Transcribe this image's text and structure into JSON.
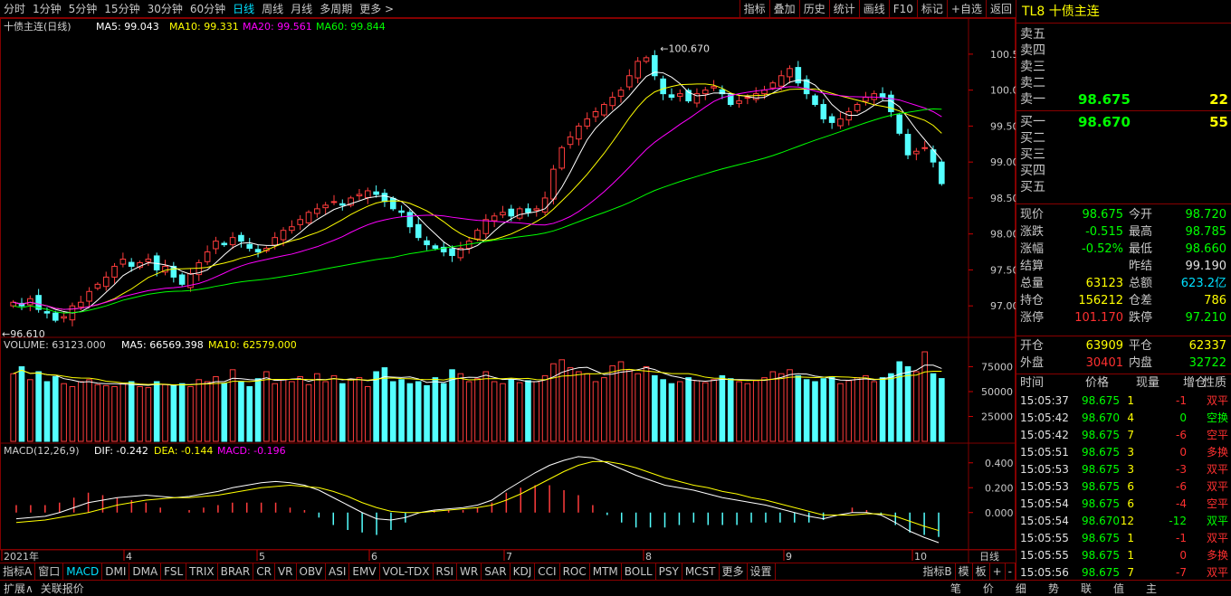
{
  "topbar": {
    "periods": [
      "分时",
      "1分钟",
      "5分钟",
      "15分钟",
      "30分钟",
      "60分钟",
      "日线",
      "周线",
      "月线",
      "多周期",
      "更多 >"
    ],
    "active_index": 6,
    "buttons": [
      "指标",
      "叠加",
      "历史",
      "统计",
      "画线",
      "F10",
      "标记",
      "+自选",
      "返回"
    ]
  },
  "chart": {
    "name": "十债主连(日线)",
    "ma": {
      "ma5": "MA5: 99.043",
      "ma10": "MA10: 99.331",
      "ma20": "MA20: 99.561",
      "ma60": "MA60: 99.844"
    },
    "price_ticks": [
      "100.5",
      "100.0",
      "99.50",
      "99.00",
      "98.50",
      "98.00",
      "97.50",
      "97.00"
    ],
    "high_label": "100.670",
    "low_label": "96.610",
    "volume_title": "VOLUME: 63123.000",
    "volume_ma5": "MA5: 66569.398",
    "volume_ma10": "MA10: 62579.000",
    "volume_ticks": [
      "75000",
      "50000",
      "25000"
    ],
    "macd_title": "MACD(12,26,9)",
    "macd_dif": "DIF: -0.242",
    "macd_dea": "DEA: -0.144",
    "macd_val": "MACD: -0.196",
    "macd_ticks": [
      "0.400",
      "0.200",
      "0.000"
    ],
    "x_labels": [
      "2021年",
      "4",
      "5",
      "6",
      "7",
      "8",
      "9",
      "10"
    ],
    "period_label": "日线",
    "colors": {
      "up": "#ff3c3c",
      "down": "#54ffff",
      "ma5": "#ffffff",
      "ma10": "#ffff00",
      "ma20": "#ff00ff",
      "ma60": "#00ff00",
      "frame": "#800000"
    }
  },
  "chart_data": [
    {
      "type": "candlestick",
      "title": "十债主连(日线)",
      "ylim": [
        96.6,
        100.75
      ],
      "x_labels": [
        "2021年",
        "4",
        "5",
        "6",
        "7",
        "8",
        "9",
        "10"
      ],
      "close": [
        97.05,
        97.0,
        97.1,
        96.95,
        96.9,
        96.8,
        96.85,
        97.0,
        97.05,
        97.2,
        97.3,
        97.4,
        97.55,
        97.65,
        97.55,
        97.6,
        97.65,
        97.5,
        97.55,
        97.4,
        97.3,
        97.45,
        97.6,
        97.75,
        97.9,
        97.85,
        97.95,
        97.9,
        97.8,
        97.75,
        97.8,
        97.95,
        98.05,
        98.1,
        98.2,
        98.3,
        98.35,
        98.4,
        98.45,
        98.4,
        98.5,
        98.55,
        98.6,
        98.55,
        98.45,
        98.35,
        98.3,
        98.1,
        97.95,
        97.85,
        97.8,
        97.75,
        97.7,
        97.8,
        97.9,
        98.05,
        98.2,
        98.25,
        98.3,
        98.25,
        98.35,
        98.3,
        98.35,
        98.5,
        98.9,
        99.2,
        99.35,
        99.5,
        99.6,
        99.7,
        99.8,
        99.9,
        100.0,
        100.2,
        100.4,
        100.45,
        100.2,
        99.95,
        99.9,
        99.95,
        99.85,
        99.95,
        100.0,
        100.05,
        99.95,
        99.8,
        99.85,
        99.9,
        99.95,
        100.0,
        100.1,
        100.2,
        100.3,
        100.1,
        99.95,
        99.8,
        99.6,
        99.55,
        99.6,
        99.7,
        99.8,
        99.9,
        99.95,
        99.9,
        99.7,
        99.4,
        99.1,
        99.15,
        99.2,
        99.0,
        98.7
      ]
    },
    {
      "type": "bar",
      "title": "VOLUME",
      "ylim": [
        0,
        100000
      ],
      "values": [
        68000,
        75000,
        62000,
        70000,
        60000,
        65000,
        58000,
        55000,
        60000,
        62000,
        57000,
        56000,
        55000,
        58000,
        60000,
        55000,
        54000,
        60000,
        57000,
        56000,
        58000,
        55000,
        62000,
        60000,
        65000,
        58000,
        72000,
        60000,
        55000,
        63000,
        70000,
        58000,
        62000,
        60000,
        65000,
        57000,
        68000,
        60000,
        66000,
        58000,
        62000,
        64000,
        55000,
        70000,
        74000,
        60000,
        62000,
        58000,
        60000,
        56000,
        64000,
        58000,
        72000,
        68000,
        60000,
        63000,
        70000,
        60000,
        58000,
        62000,
        59000,
        61000,
        60000,
        66000,
        78000,
        82000,
        74000,
        70000,
        68000,
        60000,
        64000,
        76000,
        80000,
        72000,
        68000,
        75000,
        66000,
        62000,
        58000,
        60000,
        64000,
        61000,
        59000,
        62000,
        66000,
        63000,
        60000,
        58000,
        61000,
        64000,
        70000,
        68000,
        72000,
        66000,
        62000,
        60000,
        63000,
        65000,
        58000,
        61000,
        64000,
        66000,
        60000,
        64000,
        68000,
        80000,
        75000,
        70000,
        90000,
        68000,
        63123
      ]
    },
    {
      "type": "line",
      "title": "MACD(12,26,9)",
      "ylim": [
        -0.3,
        0.5
      ],
      "dif": [
        -0.05,
        -0.04,
        -0.03,
        0.0,
        0.04,
        0.08,
        0.1,
        0.12,
        0.13,
        0.14,
        0.13,
        0.12,
        0.13,
        0.15,
        0.17,
        0.2,
        0.22,
        0.24,
        0.25,
        0.24,
        0.22,
        0.18,
        0.12,
        0.06,
        0.0,
        -0.05,
        -0.06,
        -0.04,
        0.0,
        0.02,
        0.03,
        0.04,
        0.06,
        0.1,
        0.18,
        0.25,
        0.32,
        0.38,
        0.42,
        0.45,
        0.44,
        0.4,
        0.35,
        0.3,
        0.26,
        0.22,
        0.2,
        0.18,
        0.15,
        0.12,
        0.1,
        0.08,
        0.06,
        0.03,
        0.0,
        -0.03,
        -0.05,
        -0.02,
        0.0,
        0.0,
        -0.02,
        -0.08,
        -0.15,
        -0.2,
        -0.242
      ],
      "dea": [
        -0.08,
        -0.07,
        -0.06,
        -0.04,
        -0.02,
        0.0,
        0.03,
        0.06,
        0.08,
        0.1,
        0.11,
        0.12,
        0.12,
        0.13,
        0.14,
        0.16,
        0.18,
        0.2,
        0.21,
        0.22,
        0.21,
        0.2,
        0.17,
        0.13,
        0.08,
        0.04,
        0.01,
        0.0,
        0.0,
        0.01,
        0.02,
        0.03,
        0.04,
        0.06,
        0.1,
        0.15,
        0.21,
        0.27,
        0.33,
        0.38,
        0.41,
        0.41,
        0.39,
        0.36,
        0.32,
        0.28,
        0.25,
        0.22,
        0.2,
        0.17,
        0.15,
        0.12,
        0.1,
        0.07,
        0.04,
        0.01,
        -0.02,
        -0.02,
        -0.02,
        -0.01,
        -0.01,
        -0.03,
        -0.07,
        -0.11,
        -0.144
      ]
    }
  ],
  "bottom_tabs": [
    "指标A",
    "窗口",
    "MACD",
    "DMI",
    "DMA",
    "FSL",
    "TRIX",
    "BRAR",
    "CR",
    "VR",
    "OBV",
    "ASI",
    "EMV",
    "VOL-TDX",
    "RSI",
    "WR",
    "SAR",
    "KDJ",
    "CCI",
    "ROC",
    "MTM",
    "BOLL",
    "PSY",
    "MCST",
    "更多",
    "设置"
  ],
  "bottom_right": [
    "指标B",
    "模",
    "板",
    "+",
    "-"
  ],
  "status": {
    "expand": "扩展∧",
    "quote": "关联报价",
    "right": [
      "笔",
      "价",
      "细",
      "势",
      "联",
      "值",
      "主"
    ]
  },
  "panel": {
    "title": "TL8 十债主连",
    "asks": [
      {
        "label": "卖五",
        "price": "",
        "qty": ""
      },
      {
        "label": "卖四",
        "price": "",
        "qty": ""
      },
      {
        "label": "卖三",
        "price": "",
        "qty": ""
      },
      {
        "label": "卖二",
        "price": "",
        "qty": ""
      },
      {
        "label": "卖一",
        "price": "98.675",
        "qty": "22"
      }
    ],
    "bids": [
      {
        "label": "买一",
        "price": "98.670",
        "qty": "55"
      },
      {
        "label": "买二",
        "price": "",
        "qty": ""
      },
      {
        "label": "买三",
        "price": "",
        "qty": ""
      },
      {
        "label": "买四",
        "price": "",
        "qty": ""
      },
      {
        "label": "买五",
        "price": "",
        "qty": ""
      }
    ],
    "quote": [
      {
        "k1": "现价",
        "v1": "98.675",
        "c1": "g",
        "k2": "今开",
        "v2": "98.720",
        "c2": "g"
      },
      {
        "k1": "涨跌",
        "v1": "-0.515",
        "c1": "g",
        "k2": "最高",
        "v2": "98.785",
        "c2": "g"
      },
      {
        "k1": "涨幅",
        "v1": "-0.52%",
        "c1": "g",
        "k2": "最低",
        "v2": "98.660",
        "c2": "g"
      },
      {
        "k1": "结算",
        "v1": "",
        "c1": "w",
        "k2": "昨结",
        "v2": "99.190",
        "c2": "w"
      },
      {
        "k1": "总量",
        "v1": "63123",
        "c1": "y",
        "k2": "总额",
        "v2": "623.2亿",
        "c2": "c"
      },
      {
        "k1": "持仓",
        "v1": "156212",
        "c1": "y",
        "k2": "仓差",
        "v2": "786",
        "c2": "y"
      },
      {
        "k1": "涨停",
        "v1": "101.170",
        "c1": "r",
        "k2": "跌停",
        "v2": "97.210",
        "c2": "g"
      }
    ],
    "oc": [
      {
        "k1": "开仓",
        "v1": "63909",
        "c1": "y",
        "k2": "平仓",
        "v2": "62337",
        "c2": "y"
      },
      {
        "k1": "外盘",
        "v1": "30401",
        "c1": "r",
        "k2": "内盘",
        "v2": "32722",
        "c2": "g"
      }
    ],
    "tick_headers": [
      "时间",
      "价格",
      "现量",
      "增仓",
      "性质"
    ],
    "ticks": [
      {
        "t": "15:05:37",
        "p": "98.675",
        "v": "1",
        "d": "-1",
        "n": "双平",
        "nc": "r",
        "dc": "r"
      },
      {
        "t": "15:05:42",
        "p": "98.670",
        "v": "4",
        "d": "0",
        "n": "空换",
        "nc": "g",
        "dc": "g"
      },
      {
        "t": "15:05:42",
        "p": "98.675",
        "v": "7",
        "d": "-6",
        "n": "空平",
        "nc": "r",
        "dc": "r"
      },
      {
        "t": "15:05:51",
        "p": "98.675",
        "v": "3",
        "d": "0",
        "n": "多换",
        "nc": "r",
        "dc": "r"
      },
      {
        "t": "15:05:53",
        "p": "98.675",
        "v": "3",
        "d": "-3",
        "n": "双平",
        "nc": "r",
        "dc": "r"
      },
      {
        "t": "15:05:53",
        "p": "98.675",
        "v": "6",
        "d": "-6",
        "n": "双平",
        "nc": "r",
        "dc": "r"
      },
      {
        "t": "15:05:54",
        "p": "98.675",
        "v": "6",
        "d": "-4",
        "n": "空平",
        "nc": "r",
        "dc": "r"
      },
      {
        "t": "15:05:54",
        "p": "98.670",
        "v": "12",
        "d": "-12",
        "n": "双平",
        "nc": "g",
        "dc": "g"
      },
      {
        "t": "15:05:55",
        "p": "98.675",
        "v": "1",
        "d": "-1",
        "n": "双平",
        "nc": "r",
        "dc": "r"
      },
      {
        "t": "15:05:55",
        "p": "98.675",
        "v": "1",
        "d": "0",
        "n": "多换",
        "nc": "r",
        "dc": "r"
      },
      {
        "t": "15:05:56",
        "p": "98.675",
        "v": "7",
        "d": "-7",
        "n": "双平",
        "nc": "r",
        "dc": "r"
      }
    ]
  }
}
